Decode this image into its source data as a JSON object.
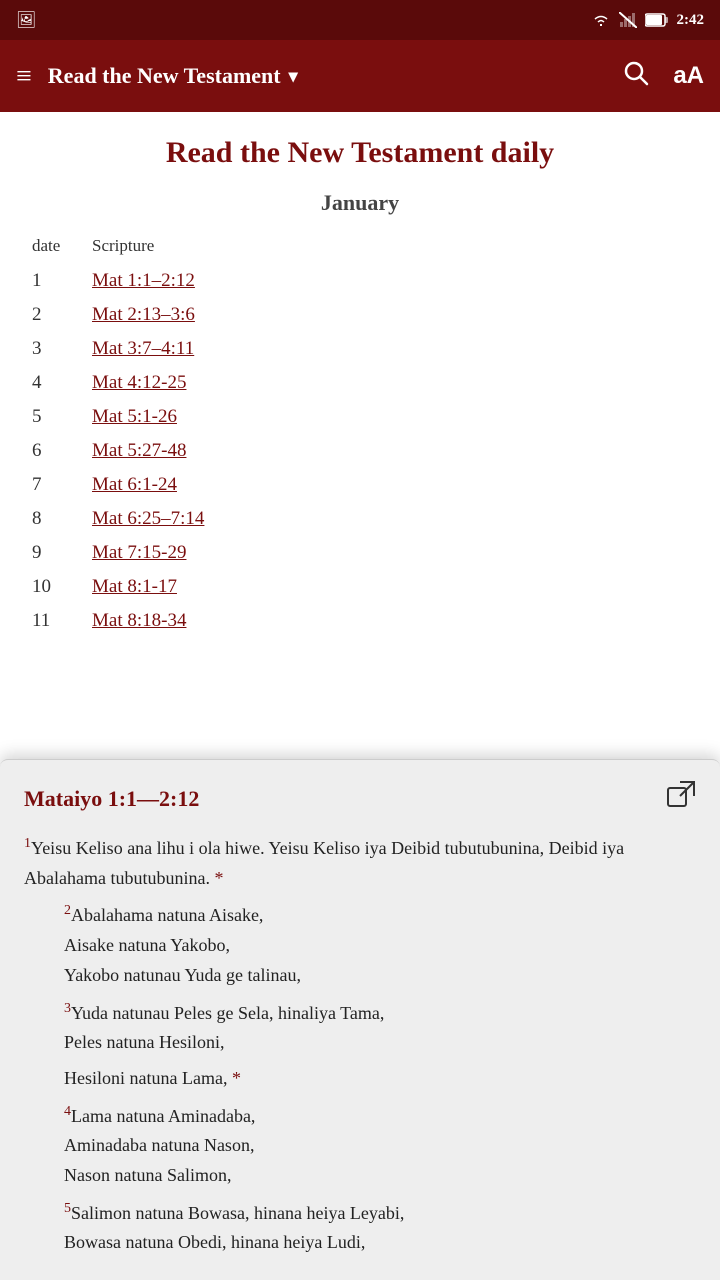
{
  "statusBar": {
    "time": "2:42",
    "wifiLabel": "wifi",
    "batteryLabel": "battery"
  },
  "toolbar": {
    "menuLabel": "≡",
    "title": "Read the New Testament",
    "dropdownArrow": "▾",
    "searchLabel": "search",
    "fontLabel": "aA"
  },
  "mainContent": {
    "pageTitle": "Read the New Testament daily",
    "monthTitle": "January",
    "columnDate": "date",
    "columnScripture": "Scripture",
    "readings": [
      {
        "day": "1",
        "ref": "Mat 1:1–2:12"
      },
      {
        "day": "2",
        "ref": "Mat 2:13–3:6"
      },
      {
        "day": "3",
        "ref": "Mat 3:7–4:11"
      },
      {
        "day": "4",
        "ref": "Mat 4:12-25"
      },
      {
        "day": "5",
        "ref": "Mat 5:1-26"
      },
      {
        "day": "6",
        "ref": "Mat 5:27-48"
      },
      {
        "day": "7",
        "ref": "Mat 6:1-24"
      },
      {
        "day": "8",
        "ref": "Mat 6:25–7:14"
      },
      {
        "day": "9",
        "ref": "Mat 7:15-29"
      },
      {
        "day": "10",
        "ref": "Mat 8:1-17"
      },
      {
        "day": "11",
        "ref": "Mat 8:18-34"
      }
    ]
  },
  "popup": {
    "title": "Mataiyo 1:1—2:12",
    "externalIconLabel": "open-external",
    "verses": [
      {
        "num": "1",
        "text": "Yeisu Keliso ana lihu i ola hiwe. Yeisu Keliso iya Deibid tubutubunina, Deibid iya Abalahama tubutubunina.",
        "hasAsterisk": true,
        "indented": false
      },
      {
        "num": "2",
        "text": "Abalahama natuna Aisake,\nAisake natuna Yakobo,\nYakobo natunau Yuda ge talinau,",
        "hasAsterisk": false,
        "indented": true
      },
      {
        "num": "3",
        "text": "Yuda natunau Peles ge Sela, hinaliya Tama,\nPeles natuna Hesiloni,",
        "hasAsterisk": false,
        "indented": true
      },
      {
        "num": "",
        "text": "Hesiloni natuna Lama,",
        "hasAsterisk": true,
        "indented": true
      },
      {
        "num": "4",
        "text": "Lama natuna Aminadaba,\nAminadaba natuna Nason,\nNason natuna Salimon,",
        "hasAsterisk": false,
        "indented": true
      },
      {
        "num": "5",
        "text": "Salimon natuna Bowasa, hinana heiya Leyabi,\nBowasa natuna Obedi, hinana heiya Ludi,",
        "hasAsterisk": false,
        "indented": true
      }
    ]
  }
}
